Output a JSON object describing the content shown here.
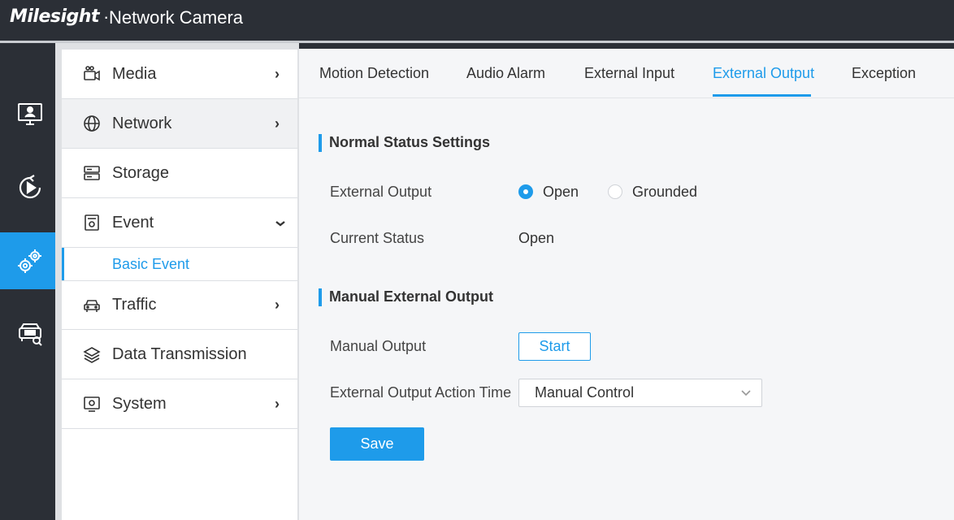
{
  "header": {
    "logo_text": "Milesight",
    "separator": "·",
    "app_title": "Network Camera"
  },
  "rail": {
    "items": [
      {
        "icon": "monitor-icon",
        "active": false
      },
      {
        "icon": "playback-icon",
        "active": false
      },
      {
        "icon": "settings-gears-icon",
        "active": true
      },
      {
        "icon": "vehicle-search-icon",
        "active": false
      }
    ]
  },
  "submenu": {
    "items": [
      {
        "label": "Media",
        "icon": "camera-icon",
        "arrow": "›"
      },
      {
        "label": "Network",
        "icon": "globe-icon",
        "arrow": "›"
      },
      {
        "label": "Storage",
        "icon": "storage-icon",
        "arrow": ""
      },
      {
        "label": "Event",
        "icon": "event-icon",
        "arrow": "⌄"
      },
      {
        "label": "Traffic",
        "icon": "car-icon",
        "arrow": "›"
      },
      {
        "label": "Data Transmission",
        "icon": "layers-icon",
        "arrow": ""
      },
      {
        "label": "System",
        "icon": "system-icon",
        "arrow": "›"
      }
    ],
    "sub_items": [
      {
        "label": "Basic Event"
      }
    ]
  },
  "tabs": [
    {
      "label": "Motion Detection",
      "active": false
    },
    {
      "label": "Audio Alarm",
      "active": false
    },
    {
      "label": "External Input",
      "active": false
    },
    {
      "label": "External Output",
      "active": true
    },
    {
      "label": "Exception",
      "active": false
    }
  ],
  "normal_status": {
    "title": "Normal Status Settings",
    "external_output_label": "External Output",
    "options": [
      "Open",
      "Grounded"
    ],
    "selected": "Open",
    "current_status_label": "Current Status",
    "current_status_value": "Open"
  },
  "manual_output": {
    "title": "Manual External Output",
    "manual_output_label": "Manual Output",
    "start_button": "Start",
    "action_time_label": "External Output Action Time",
    "action_time_value": "Manual Control"
  },
  "save_button": "Save",
  "colors": {
    "accent": "#1e9bea",
    "header_bg": "#2b2f36"
  }
}
